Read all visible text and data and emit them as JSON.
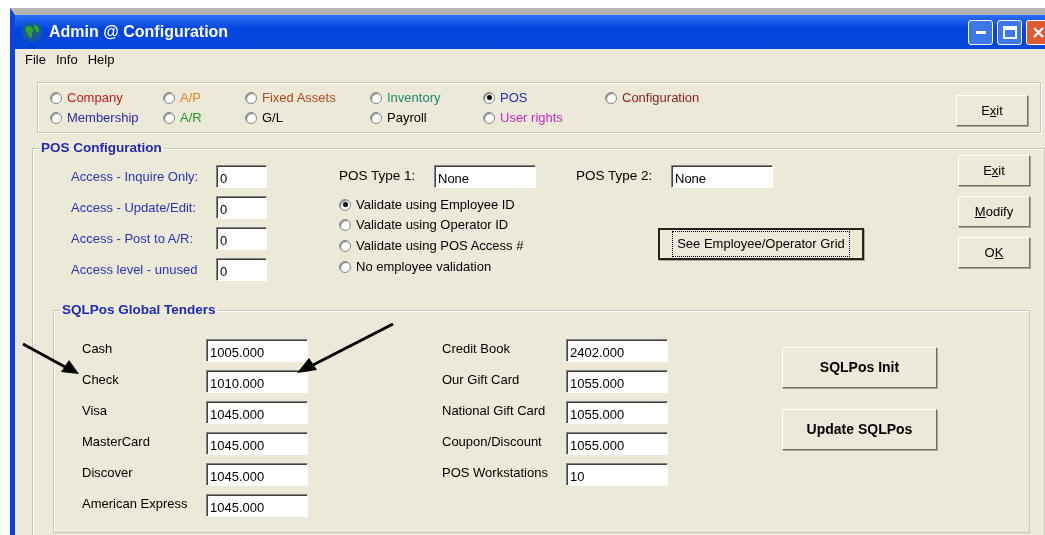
{
  "window": {
    "title": "Admin @ Configuration"
  },
  "menu": [
    "File",
    "Info",
    "Help"
  ],
  "modules": [
    {
      "label": "Company",
      "color": "#c41a1a",
      "selected": false
    },
    {
      "label": "A/P",
      "color": "#e8841c",
      "selected": false
    },
    {
      "label": "Fixed Assets",
      "color": "#b5481c",
      "selected": false
    },
    {
      "label": "Inventory",
      "color": "#1f8a70",
      "selected": false
    },
    {
      "label": "POS",
      "color": "#2a2ab8",
      "selected": true
    },
    {
      "label": "Configuration",
      "color": "#8c1c1c",
      "selected": false
    },
    {
      "label": "Membership",
      "color": "#2a2ab0",
      "selected": false
    },
    {
      "label": "A/R",
      "color": "#1f9a2a",
      "selected": false
    },
    {
      "label": "G/L",
      "color": "#000000",
      "selected": false
    },
    {
      "label": "Payroll",
      "color": "#000000",
      "selected": false
    },
    {
      "label": "User rights",
      "color": "#c42ac4",
      "selected": false
    }
  ],
  "exit_button": {
    "before": "E",
    "underlined": "x",
    "after": "it"
  },
  "pos_configuration": {
    "title": "POS Configuration",
    "access_fields": [
      {
        "label": "Access - Inquire Only:",
        "value": "0"
      },
      {
        "label": "Access - Update/Edit:",
        "value": "0"
      },
      {
        "label": "Access - Post to A/R:",
        "value": "0"
      },
      {
        "label": "Access level - unused",
        "value": "0"
      }
    ],
    "pos_type_1": {
      "label": "POS Type 1:",
      "value": "None"
    },
    "pos_type_2": {
      "label": "POS Type 2:",
      "value": "None"
    },
    "validation_options": [
      {
        "label": "Validate using Employee ID",
        "selected": true
      },
      {
        "label": "Validate using Operator ID",
        "selected": false
      },
      {
        "label": "Validate using POS Access #",
        "selected": false
      },
      {
        "label": "No employee validation",
        "selected": false
      }
    ],
    "grid_button": {
      "label": "See Employee/Operator Grid",
      "focused": true
    },
    "buttons": [
      {
        "before": "E",
        "underlined": "x",
        "after": "it"
      },
      {
        "underlined": "M",
        "after": "odify"
      },
      {
        "before": "O",
        "underlined": "K"
      }
    ]
  },
  "tenders": {
    "title": "SQLPos Global Tenders",
    "left": [
      {
        "label": "Cash",
        "value": "1005.000"
      },
      {
        "label": "Check",
        "value": "1010.000"
      },
      {
        "label": "Visa",
        "value": "1045.000"
      },
      {
        "label": "MasterCard",
        "value": "1045.000"
      },
      {
        "label": "Discover",
        "value": "1045.000"
      },
      {
        "label": "American Express",
        "value": "1045.000"
      }
    ],
    "right": [
      {
        "label": "Credit Book",
        "value": "2402.000"
      },
      {
        "label": "Our Gift Card",
        "value": "1055.000"
      },
      {
        "label": "National Gift Card",
        "value": "1055.000"
      },
      {
        "label": "Coupon/Discount",
        "value": "1055.000"
      },
      {
        "label": "POS Workstations",
        "value": "10"
      }
    ],
    "buttons": [
      "SQLPos Init",
      "Update SQLPos"
    ]
  }
}
